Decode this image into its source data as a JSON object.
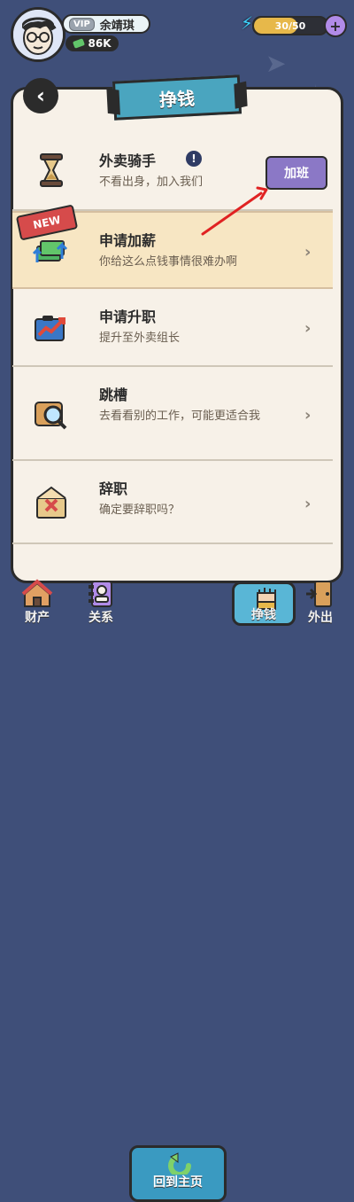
{
  "topbar": {
    "vip_label": "VIP",
    "player_name": "余靖琪",
    "money": "86K",
    "energy_text": "30/50",
    "energy_fraction": 0.6,
    "add_label": "+",
    "energy_icon": "lightning-icon"
  },
  "panel": {
    "title": "挣钱",
    "back_icon": "back-arrow-icon"
  },
  "job": {
    "title": "外卖骑手",
    "desc": "不看出身，加入我们",
    "info_icon": "!",
    "overtime_label": "加班"
  },
  "items": [
    {
      "title": "申请加薪",
      "desc": "你给这么点钱事情很难办啊",
      "icon": "money-raise-icon",
      "badge": "NEW",
      "chevron": "›",
      "highlight": true
    },
    {
      "title": "申请升职",
      "desc": "提升至外卖组长",
      "icon": "promotion-chart-icon",
      "chevron": "›",
      "highlight": false
    },
    {
      "title": "跳槽",
      "desc": "去看看别的工作，可能更适合我",
      "icon": "magnifier-icon",
      "chevron": "›",
      "highlight": false
    },
    {
      "title": "辞职",
      "desc": "确定要辞职吗？",
      "icon": "resignation-letter-icon",
      "chevron": "›",
      "highlight": false
    }
  ],
  "bottom_nav": {
    "assets": "财产",
    "relations": "关系",
    "home": "回到主页",
    "earn": "挣钱",
    "go_out": "外出"
  },
  "colors": {
    "background": "#3f4f79",
    "panel": "#f7f1e8",
    "accent_purple": "#8b78c6",
    "accent_blue": "#4aa5bf",
    "annotation_red": "#e02222"
  }
}
